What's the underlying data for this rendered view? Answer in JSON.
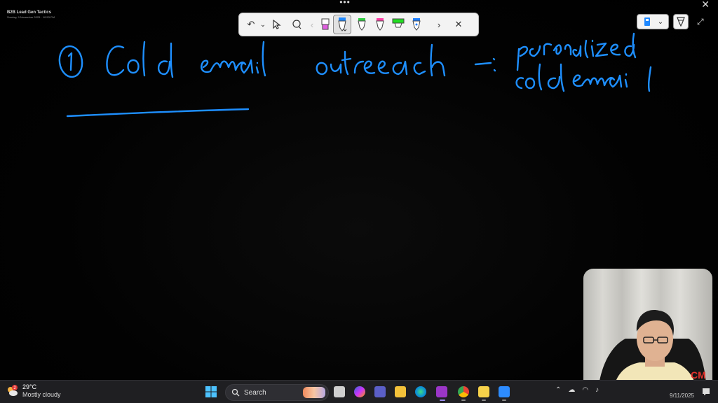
{
  "window": {
    "handle_glyph": "•••",
    "close_glyph": "✕",
    "doc_title": "B2B Lead Gen Tactics",
    "doc_subtitle": "Sunday, 9 November 2025 · 10:53 PM"
  },
  "pen_toolbar": {
    "icons": [
      "undo-icon",
      "chevron-down-icon",
      "select-icon",
      "lasso-icon",
      "chevron-left-icon",
      "highlighter-pink",
      "pen-blue-selected",
      "pen-green",
      "pen-pink",
      "highlighter-green",
      "pen-white",
      "chevron-right-icon",
      "close-icon"
    ],
    "undo_glyph": "↶",
    "chevron_down_glyph": "⌄",
    "prev_glyph": "‹",
    "next_glyph": "›",
    "close_glyph": "✕",
    "pen_colors": {
      "pink_highlighter": "#e060e0",
      "blue_pen": "#1e88ff",
      "green_pen": "#2ecc40",
      "pink_pen": "#ff3ea5",
      "green_highlighter": "#22dd22",
      "white_pen": "#2080ff"
    }
  },
  "right_tools": {
    "chevron_glyph": "⌄",
    "expand_glyph": "⤢"
  },
  "handwriting": {
    "ink_color": "#1e8fff",
    "line1": "① Cold email outreach - personalized cold email"
  },
  "webcam": {
    "badge_text": "CM"
  },
  "taskbar": {
    "weather_temp": "29°C",
    "weather_condition": "Mostly cloudy",
    "weather_badge": "2",
    "search_label": "Search",
    "clock_date": "9/11/2025",
    "apps": [
      "task-view",
      "copilot",
      "teams",
      "file-explorer",
      "edge",
      "onenote",
      "chrome",
      "sticky-notes",
      "zoom"
    ],
    "tray_icons": [
      "chevron-up-icon",
      "cloud-icon",
      "wifi-icon",
      "volume-icon",
      "microphone-icon"
    ]
  }
}
